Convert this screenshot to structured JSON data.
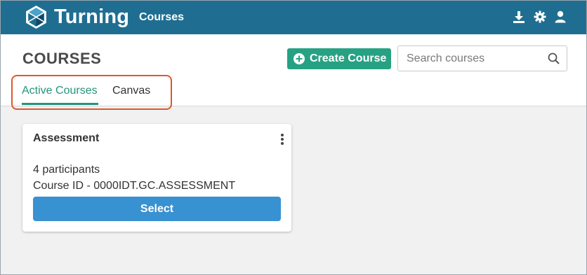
{
  "topbar": {
    "brand": "Turning",
    "nav_courses": "Courses",
    "icons": [
      "download-icon",
      "gear-icon",
      "user-icon"
    ],
    "color": "#1f6e91"
  },
  "header": {
    "title": "COURSES",
    "create_button": "Create Course",
    "search_placeholder": "Search courses"
  },
  "tabs": [
    {
      "label": "Active Courses",
      "active": true
    },
    {
      "label": "Canvas",
      "active": false
    }
  ],
  "courses": [
    {
      "name": "Assessment",
      "participants": "4 participants",
      "course_id": "Course ID - 0000IDT.GC.ASSESSMENT",
      "select_label": "Select"
    }
  ],
  "colors": {
    "accent_green": "#26a283",
    "tab_active": "#21967a",
    "select_blue": "#3891d1",
    "highlight": "#e0572b"
  }
}
